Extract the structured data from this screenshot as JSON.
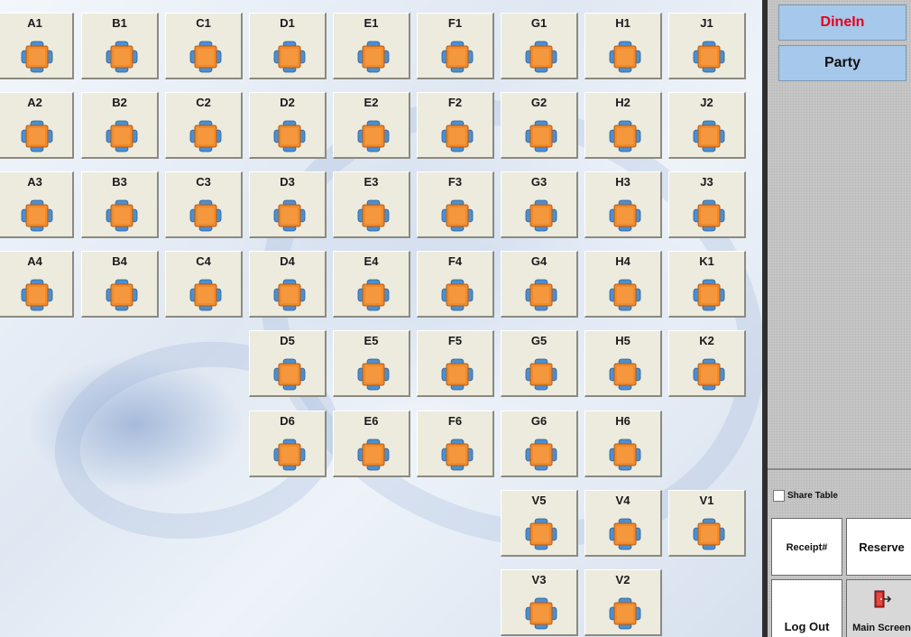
{
  "tables": [
    {
      "label": "A1",
      "col": 0,
      "row": 0
    },
    {
      "label": "B1",
      "col": 1,
      "row": 0
    },
    {
      "label": "C1",
      "col": 2,
      "row": 0
    },
    {
      "label": "D1",
      "col": 3,
      "row": 0
    },
    {
      "label": "E1",
      "col": 4,
      "row": 0
    },
    {
      "label": "F1",
      "col": 5,
      "row": 0
    },
    {
      "label": "G1",
      "col": 6,
      "row": 0
    },
    {
      "label": "H1",
      "col": 7,
      "row": 0
    },
    {
      "label": "J1",
      "col": 8,
      "row": 0
    },
    {
      "label": "A2",
      "col": 0,
      "row": 1
    },
    {
      "label": "B2",
      "col": 1,
      "row": 1
    },
    {
      "label": "C2",
      "col": 2,
      "row": 1
    },
    {
      "label": "D2",
      "col": 3,
      "row": 1
    },
    {
      "label": "E2",
      "col": 4,
      "row": 1
    },
    {
      "label": "F2",
      "col": 5,
      "row": 1
    },
    {
      "label": "G2",
      "col": 6,
      "row": 1
    },
    {
      "label": "H2",
      "col": 7,
      "row": 1
    },
    {
      "label": "J2",
      "col": 8,
      "row": 1
    },
    {
      "label": "A3",
      "col": 0,
      "row": 2
    },
    {
      "label": "B3",
      "col": 1,
      "row": 2
    },
    {
      "label": "C3",
      "col": 2,
      "row": 2
    },
    {
      "label": "D3",
      "col": 3,
      "row": 2
    },
    {
      "label": "E3",
      "col": 4,
      "row": 2
    },
    {
      "label": "F3",
      "col": 5,
      "row": 2
    },
    {
      "label": "G3",
      "col": 6,
      "row": 2
    },
    {
      "label": "H3",
      "col": 7,
      "row": 2
    },
    {
      "label": "J3",
      "col": 8,
      "row": 2
    },
    {
      "label": "A4",
      "col": 0,
      "row": 3
    },
    {
      "label": "B4",
      "col": 1,
      "row": 3
    },
    {
      "label": "C4",
      "col": 2,
      "row": 3
    },
    {
      "label": "D4",
      "col": 3,
      "row": 3
    },
    {
      "label": "E4",
      "col": 4,
      "row": 3
    },
    {
      "label": "F4",
      "col": 5,
      "row": 3
    },
    {
      "label": "G4",
      "col": 6,
      "row": 3
    },
    {
      "label": "H4",
      "col": 7,
      "row": 3
    },
    {
      "label": "K1",
      "col": 8,
      "row": 3
    },
    {
      "label": "D5",
      "col": 3,
      "row": 4
    },
    {
      "label": "E5",
      "col": 4,
      "row": 4
    },
    {
      "label": "F5",
      "col": 5,
      "row": 4
    },
    {
      "label": "G5",
      "col": 6,
      "row": 4
    },
    {
      "label": "H5",
      "col": 7,
      "row": 4
    },
    {
      "label": "K2",
      "col": 8,
      "row": 4
    },
    {
      "label": "D6",
      "col": 3,
      "row": 5
    },
    {
      "label": "E6",
      "col": 4,
      "row": 5
    },
    {
      "label": "F6",
      "col": 5,
      "row": 5
    },
    {
      "label": "G6",
      "col": 6,
      "row": 5
    },
    {
      "label": "H6",
      "col": 7,
      "row": 5
    },
    {
      "label": "V5",
      "col": 6,
      "row": 6
    },
    {
      "label": "V4",
      "col": 7,
      "row": 6
    },
    {
      "label": "V1",
      "col": 8,
      "row": 6
    },
    {
      "label": "V3",
      "col": 6,
      "row": 7
    },
    {
      "label": "V2",
      "col": 7,
      "row": 7
    }
  ],
  "table_icon": "table-with-chairs-icon",
  "sidebar": {
    "modes": [
      {
        "label": "DineIn",
        "color": "#e8001c",
        "active": true
      },
      {
        "label": "Party",
        "color": "#101010",
        "active": false
      }
    ],
    "share_table": {
      "label": "Share Table",
      "checked": false
    },
    "actions": {
      "receipt_label": "Receipt#",
      "reserve_label": "Reserve",
      "logout_label": "Log Out",
      "main_screen_label": "Main Screen"
    }
  },
  "colors": {
    "tile_bg": "#ecebde",
    "table_orange": "#f08a2c",
    "chair_blue": "#4c8fd0",
    "mode_button_bg": "#a6c8ea",
    "dinein_red": "#e8001c"
  }
}
